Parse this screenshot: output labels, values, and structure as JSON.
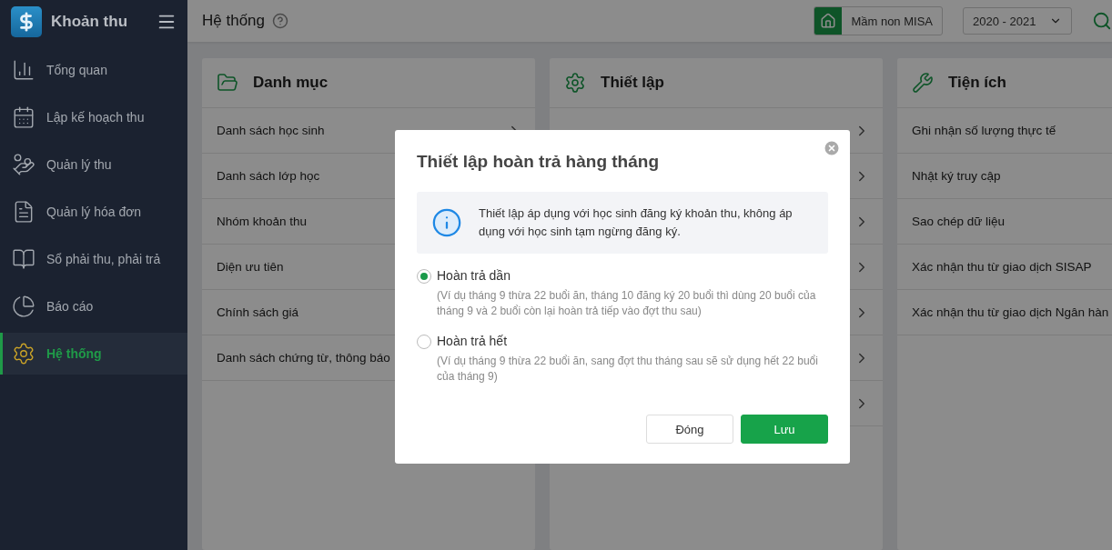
{
  "app": {
    "title": "Khoản thu"
  },
  "sidebar": {
    "items": [
      {
        "label": "Tổng quan",
        "kind": "chart",
        "selected": false
      },
      {
        "label": "Lập kế hoạch thu",
        "kind": "calendar",
        "selected": false
      },
      {
        "label": "Quản lý thu",
        "kind": "coins",
        "selected": false
      },
      {
        "label": "Quản lý hóa đơn",
        "kind": "invoice",
        "selected": false
      },
      {
        "label": "Sổ phải thu, phải trả",
        "kind": "book",
        "selected": false
      },
      {
        "label": "Báo cáo",
        "kind": "report",
        "selected": false
      },
      {
        "label": "Hệ thống",
        "kind": "settings",
        "selected": true
      }
    ]
  },
  "header": {
    "title": "Hệ thống",
    "school": "Mầm non MISA",
    "year": "2020 - 2021"
  },
  "cards": [
    {
      "title": "Danh mục",
      "kind": "folder",
      "rows": [
        {
          "label": "Danh sách học sinh",
          "chevron": true
        },
        {
          "label": "Danh sách lớp học",
          "chevron": false
        },
        {
          "label": "Nhóm khoản thu",
          "chevron": false
        },
        {
          "label": "Diện ưu tiên",
          "chevron": false
        },
        {
          "label": "Chính sách giá",
          "chevron": false
        },
        {
          "label": "Danh sách chứng từ, thông báo",
          "chevron": false
        }
      ]
    },
    {
      "title": "Thiết lập",
      "kind": "settings",
      "rows": [
        {
          "chevron": true
        },
        {
          "chevron": true
        },
        {
          "chevron": true
        },
        {
          "chevron": true
        },
        {
          "chevron": true
        },
        {
          "chevron": true
        },
        {
          "chevron": true
        }
      ]
    },
    {
      "title": "Tiện ích",
      "kind": "tools",
      "rows": [
        {
          "label": "Ghi nhận số lượng thực tế",
          "chevron": false
        },
        {
          "label": "Nhật ký truy cập",
          "chevron": false
        },
        {
          "label": "Sao chép dữ liệu",
          "chevron": false
        },
        {
          "label": "Xác nhận thu từ giao dịch SISAP",
          "chevron": false
        },
        {
          "label": "Xác nhận thu từ giao dịch Ngân hàn",
          "chevron": false
        }
      ]
    }
  ],
  "dialog": {
    "title": "Thiết lập hoàn trả hàng tháng",
    "info": "Thiết lập áp dụng với học sinh đăng ký khoản thu, không áp dụng với học sinh tạm ngừng đăng ký.",
    "options": [
      {
        "label": "Hoàn trả dần",
        "description": "(Ví dụ tháng 9 thừa 22 buổi ăn, tháng 10 đăng ký 20 buổi thì dùng 20 buổi của tháng 9 và 2 buổi còn lại hoàn trả tiếp vào đợt thu sau)",
        "selected": true
      },
      {
        "label": "Hoàn trả hết",
        "description": "(Ví dụ tháng 9 thừa 22 buổi ăn, sang đợt thu tháng sau sẽ sử dụng hết 22 buổi của tháng 9)",
        "selected": false
      }
    ],
    "buttons": {
      "close": "Đóng",
      "save": "Lưu"
    }
  }
}
